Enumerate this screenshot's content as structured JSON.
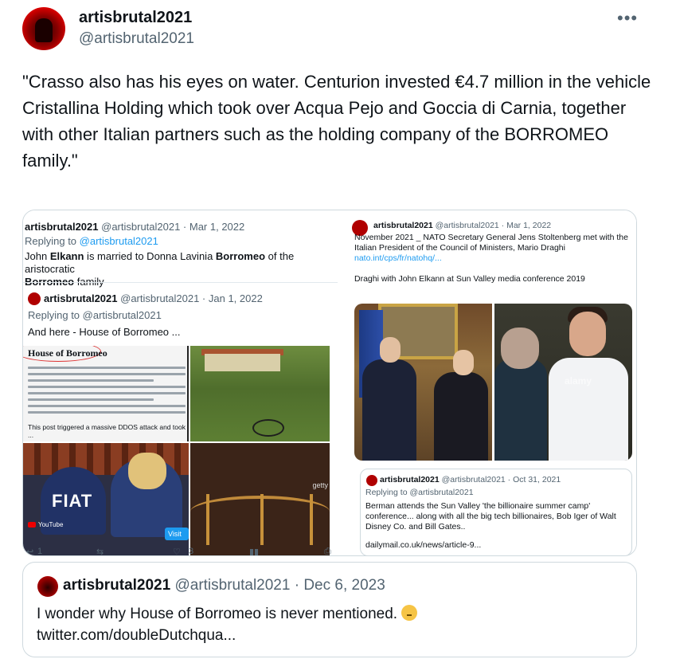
{
  "tweet": {
    "author_name": "artisbrutal2021",
    "author_handle": "@artisbrutal2021",
    "more_icon": "more-horizontal-icon",
    "text": "\"Crasso also has his eyes on water. Centurion invested €4.7 million in the vehicle Cristallina Holding which took over Acqua Pejo and Goccia di Carnia, together with other Italian partners such as the holding company of the BORROMEO family.\""
  },
  "left_image": {
    "author": "artisbrutal2021",
    "handle_date": "@artisbrutal2021 · Mar 1, 2022",
    "replying_prefix": "Replying to ",
    "replying_handle": "@artisbrutal2021",
    "text_a": "John ",
    "text_b": "Elkann",
    "text_c": " is married to Donna Lavinia ",
    "text_d": "Borromeo",
    "text_e": " of the aristocratic ",
    "text_f": "Borromeo",
    "text_g": " family",
    "inner_author": "artisbrutal2021",
    "inner_handle_date": "@artisbrutal2021 · Jan 1, 2022",
    "inner_replying": "Replying to @artisbrutal2021",
    "inner_text": "And here - House of Borromeo ...",
    "doc_title": "House of Borromeo",
    "doc_caption": "This post triggered a massive DDOS attack and took ...",
    "t3_text": "FIAT",
    "youtube": "YouTube",
    "getty": "getty",
    "visit": "Visit",
    "action_reply": "1",
    "action_likes": "3"
  },
  "right_image": {
    "author": "artisbrutal2021",
    "handle_date": "@artisbrutal2021 · Mar 1, 2022",
    "line1": "November 2021 _  NATO Secretary General Jens Stoltenberg met with the",
    "line2": "Italian President of the Council of Ministers, Mario Draghi",
    "link": "nato.int/cps/fr/natohq/...",
    "line3": "Draghi with John Elkann at Sun Valley media conference 2019",
    "watermark": "alamy",
    "quoted": {
      "author": "artisbrutal2021",
      "handle_date": "@artisbrutal2021 · Oct 31, 2021",
      "replying": "Replying to @artisbrutal2021",
      "text": "Berman attends the Sun Valley 'the billionaire summer camp' conference... along with all the big tech billionaires, Bob Iger of Walt Disney Co. and Bill Gates..",
      "link": "dailymail.co.uk/news/article-9..."
    }
  },
  "quoted_tweet": {
    "author_name": "artisbrutal2021",
    "handle_date": "@artisbrutal2021 · Dec 6, 2023",
    "text": "I wonder why House of Borromeo is never mentioned.",
    "emoji": "thinking-face-emoji",
    "link": "twitter.com/doubleDutchqua..."
  }
}
